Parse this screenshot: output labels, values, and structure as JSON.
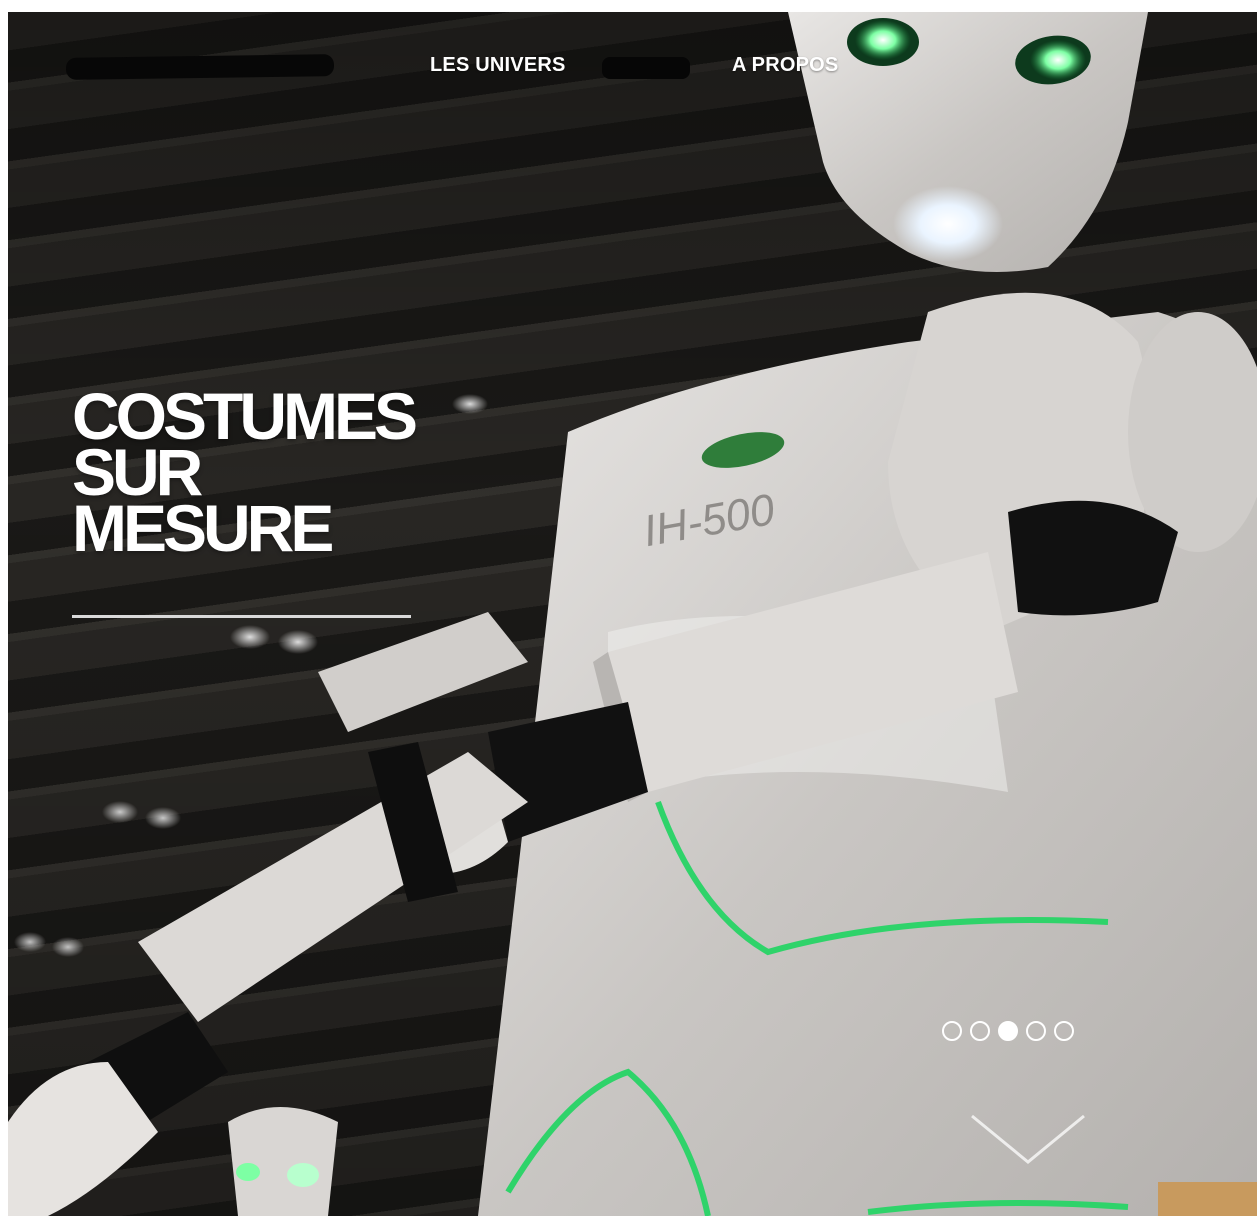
{
  "nav": {
    "items": [
      {
        "label": "LES UNIVERS"
      },
      {
        "label": "A PROPOS"
      }
    ]
  },
  "hero": {
    "headline_lines": [
      "COSTUMES",
      "SUR",
      "MESURE"
    ],
    "carousel": {
      "slide_count": 5,
      "active_index": 2
    }
  },
  "colors": {
    "text": "#ffffff",
    "divider": "#d9d9d9",
    "accent_glow": "#3ddc6e",
    "redaction": "#060606"
  },
  "icons": {
    "scroll": "chevron-down-icon"
  }
}
